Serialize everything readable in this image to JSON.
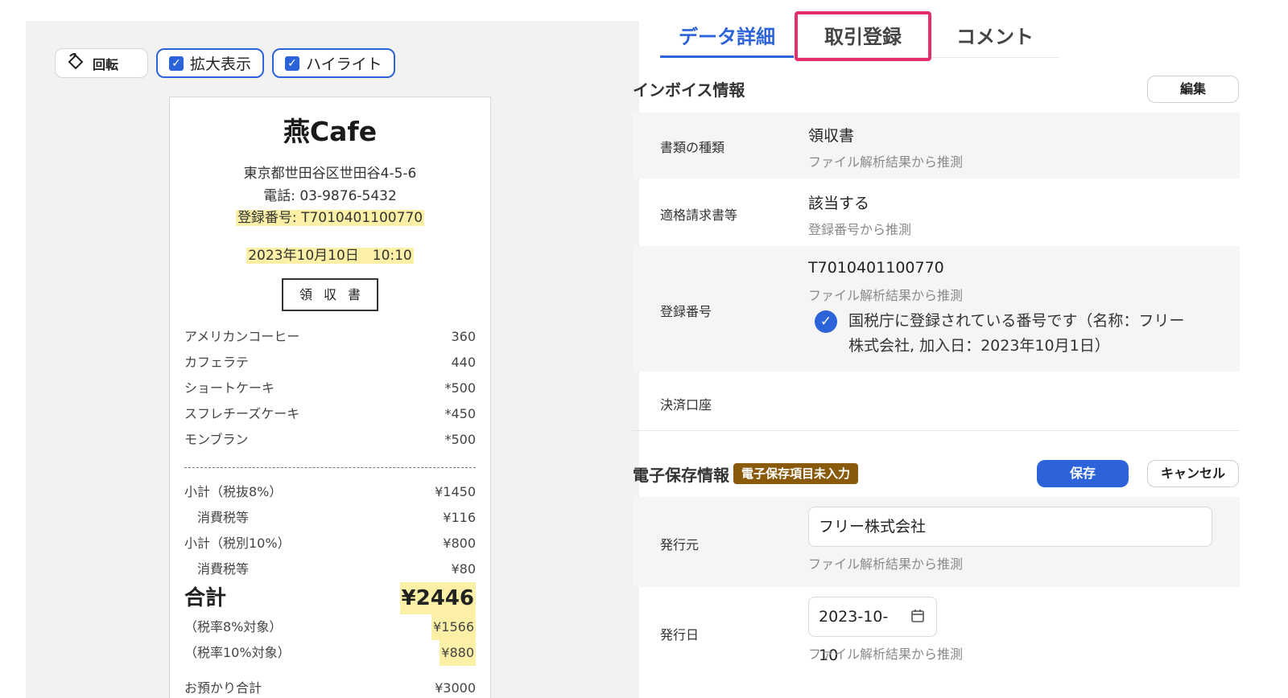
{
  "toolbar": {
    "rotate_label": "回転",
    "zoom_label": "拡大表示",
    "highlight_label": "ハイライト"
  },
  "receipt": {
    "shop_name": "燕Cafe",
    "address": "東京都世田谷区世田谷4-5-6",
    "phone": "電話: 03-9876-5432",
    "registration": "登録番号: T7010401100770",
    "datetime": "2023年10月10日　10:10",
    "doc_title": "領収書",
    "items": [
      {
        "name": "アメリカンコーヒー",
        "price": "360"
      },
      {
        "name": "カフェラテ",
        "price": "440"
      },
      {
        "name": "ショートケーキ",
        "price": "*500"
      },
      {
        "name": "スフレチーズケーキ",
        "price": "*450"
      },
      {
        "name": "モンブラン",
        "price": "*500"
      }
    ],
    "sub8_label": "小計（税抜8%）",
    "sub8_value": "¥1450",
    "tax8_label": "消費税等",
    "tax8_value": "¥116",
    "sub10_label": "小計（税別10%）",
    "sub10_value": "¥800",
    "tax10_label": "消費税等",
    "tax10_value": "¥80",
    "total_label": "合計",
    "total_value": "¥2446",
    "rate8_label": "（税率8%対象）",
    "rate8_value": "¥1566",
    "rate10_label": "（税率10%対象）",
    "rate10_value": "¥880",
    "deposit_label": "お預かり合計",
    "deposit_value": "¥3000"
  },
  "tabs": {
    "details": "データ詳細",
    "register": "取引登録",
    "comment": "コメント"
  },
  "invoice": {
    "title": "インボイス情報",
    "edit_label": "編集",
    "doc_type_label": "書類の種類",
    "doc_type_value": "領収書",
    "doc_type_note": "ファイル解析結果から推測",
    "qualified_label": "適格請求書等",
    "qualified_value": "該当する",
    "qualified_note": "登録番号から推測",
    "regno_label": "登録番号",
    "regno_value": "T7010401100770",
    "regno_note": "ファイル解析結果から推測",
    "regno_verify": "国税庁に登録されている番号です（名称：フリー株式会社, 加入日：2023年10月1日）",
    "account_label": "決済口座"
  },
  "estorage": {
    "title": "電子保存情報",
    "badge": "電子保存項目未入力",
    "save_label": "保存",
    "cancel_label": "キャンセル",
    "issuer_label": "発行元",
    "issuer_value": "フリー株式会社",
    "issuer_note": "ファイル解析結果から推測",
    "date_label": "発行日",
    "date_value": "2023-10-10",
    "date_note": "ファイル解析結果から推測"
  },
  "colors": {
    "accent": "#2d63d9",
    "highlight_box": "#e52d6d",
    "badge": "#8a5a0c",
    "receipt_highlight": "#fbf0a6"
  },
  "icons": {
    "rotate": "rotate-icon",
    "checkbox": "checkbox-checked-icon",
    "verified": "check-circle-icon",
    "calendar": "calendar-icon"
  }
}
